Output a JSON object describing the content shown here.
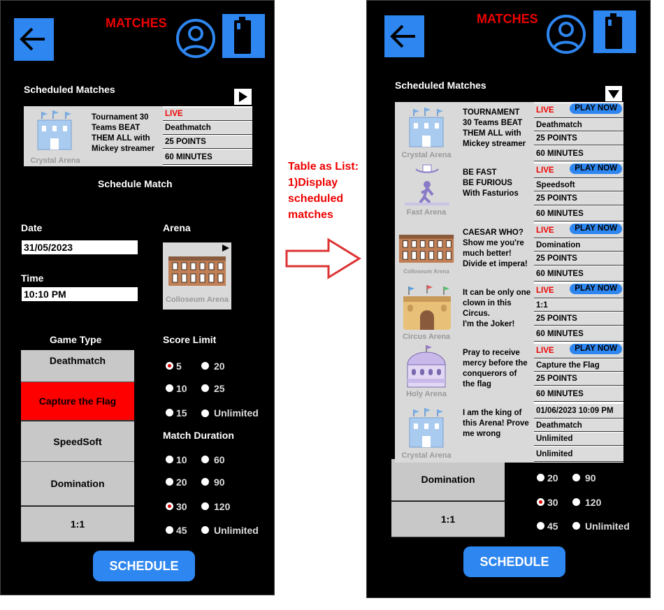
{
  "left_screen": {
    "title": "MATCHES",
    "scheduled_title": "Scheduled Matches",
    "card": {
      "desc": [
        "Tournament 30",
        "Teams BEAT",
        "THEM ALL with",
        "Mickey streamer"
      ],
      "arena": "Crystal Arena",
      "live": "LIVE",
      "mode": "Deathmatch",
      "points": "25 POINTS",
      "duration": "60 MINUTES"
    },
    "schedule_match_title": "Schedule Match",
    "date_label": "Date",
    "date_value": "31/05/2023",
    "time_label": "Time",
    "time_value": "10:10 PM",
    "arena_label": "Arena",
    "arena_name": "Colloseum Arena",
    "game_type_label": "Game Type",
    "game_types": [
      "Deathmatch",
      "Capture the Flag",
      "SpeedSoft",
      "Domination",
      "1:1"
    ],
    "score_limit_label": "Score Limit",
    "score_options": [
      "5",
      "20",
      "10",
      "25",
      "15",
      "Unlimited"
    ],
    "match_duration_label": "Match Duration",
    "duration_options": [
      "10",
      "60",
      "20",
      "90",
      "30",
      "120",
      "45",
      "Unlimited"
    ],
    "schedule_button": "SCHEDULE"
  },
  "annotation": {
    "lines": [
      "Table as List:",
      "1)Display",
      "scheduled",
      "matches"
    ]
  },
  "right_screen": {
    "title": "MATCHES",
    "scheduled_title": "Scheduled Matches",
    "play_label": "PLAY NOW",
    "matches": [
      {
        "desc": [
          "TOURNAMENT",
          "30 Teams BEAT",
          "THEM ALL with",
          "Mickey streamer"
        ],
        "arena": "Crystal Arena",
        "status": "LIVE",
        "mode": "Deathmatch",
        "points": "25 POINTS",
        "duration": "60 MINUTES"
      },
      {
        "desc": [
          "BE FAST",
          "BE FURIOUS",
          "With Fasturios"
        ],
        "arena": "Fast Arena",
        "status": "LIVE",
        "mode": "Speedsoft",
        "points": "25 POINTS",
        "duration": "60 MINUTES"
      },
      {
        "desc": [
          "CAESAR WHO?",
          "Show me you're",
          "much better!",
          "Divide et impera!"
        ],
        "arena": "Colloseum Arena",
        "status": "LIVE",
        "mode": "Domination",
        "points": "25 POINTS",
        "duration": "60 MINUTES"
      },
      {
        "desc": [
          "It can be only one",
          "clown in this",
          "Circus.",
          "I'm the Joker!"
        ],
        "arena": "Circus Arena",
        "status": "LIVE",
        "mode": "1:1",
        "points": "25 POINTS",
        "duration": "60 MINUTES"
      },
      {
        "desc": [
          "Pray to receive",
          "mercy before the",
          "conquerors of",
          "the flag"
        ],
        "arena": "Holy Arena",
        "status": "LIVE",
        "mode": "Capture the Flag",
        "points": "25 POINTS",
        "duration": "60 MINUTES"
      },
      {
        "desc": [
          "I am the king of",
          "this Arena! Prove",
          "me wrong"
        ],
        "arena": "Crystal Arena",
        "status": "01/06/2023 10:09 PM",
        "mode": "Deathmatch",
        "points": "Unlimited",
        "duration": "Unlimited"
      }
    ],
    "game_types": [
      "Domination",
      "1:1"
    ],
    "duration_options": [
      "20",
      "90",
      "30",
      "120",
      "45",
      "Unlimited"
    ],
    "schedule_button": "SCHEDULE"
  }
}
